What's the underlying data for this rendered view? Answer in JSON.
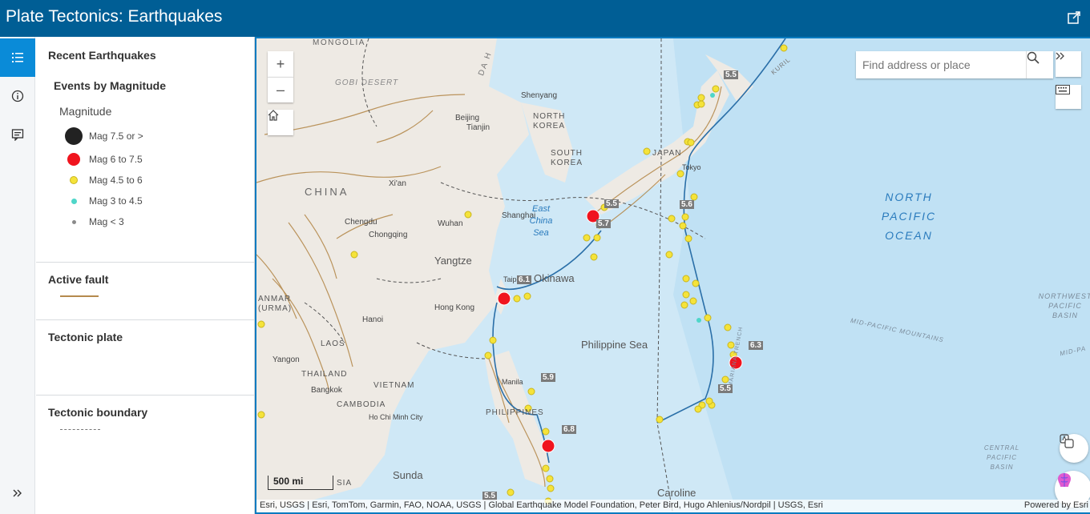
{
  "app": {
    "title": "Plate Tectonics: Earthquakes"
  },
  "rail": {
    "items": [
      {
        "name": "legend",
        "icon": "legend-list-icon",
        "active": true
      },
      {
        "name": "about",
        "icon": "info-icon",
        "active": false
      },
      {
        "name": "details",
        "icon": "details-panel-icon",
        "active": false
      }
    ],
    "expand_icon": "double-chevron-right-icon"
  },
  "legend": {
    "section1_title": "Recent Earthquakes",
    "subsection_title": "Events by Magnitude",
    "field_label": "Magnitude",
    "classes": [
      {
        "label": "Mag 7.5 or >",
        "color": "#222222"
      },
      {
        "label": "Mag 6 to 7.5",
        "color": "#f0141e"
      },
      {
        "label": "Mag 4.5 to 6",
        "color": "#f5e33a"
      },
      {
        "label": "Mag 3 to 4.5",
        "color": "#4fd6c9"
      },
      {
        "label": "Mag < 3",
        "color": "#8a8a8a"
      }
    ],
    "fault_title": "Active fault",
    "fault_color": "#b58a4d",
    "plate_title": "Tectonic plate",
    "boundary_title": "Tectonic boundary"
  },
  "map": {
    "search_placeholder": "Find address or place",
    "zoom_in": "+",
    "zoom_out": "–",
    "scale_label": "500 mi",
    "attribution": "Esri, USGS | Esri, TomTom, Garmin, FAO, NOAA, USGS | Global Earthquake Model Foundation, Peter Bird, Hugo Ahlenius/Nordpil | USGS, Esri",
    "powered_by": "Powered by Esri",
    "labels": {
      "mongolia": "MONGOLIA",
      "gobi": "GOBI DESERT",
      "china": "CHINA",
      "da_h": "DA H",
      "shenyang": "Shenyang",
      "beijing": "Beijing",
      "tianjin": "Tianjin",
      "north_korea": "NORTH KOREA",
      "south_korea": "SOUTH KOREA",
      "japan": "JAPAN",
      "tokyo": "Tokyo",
      "xian": "Xi'an",
      "wuhan": "Wuhan",
      "shanghai": "Shanghai",
      "chengdu": "Chengdu",
      "chongqing": "Chongqing",
      "yangtze": "Yangtze",
      "east_china_sea": "East China Sea",
      "okinawa": "Okinawa",
      "taipei": "Taipei",
      "hong_kong": "Hong Kong",
      "hanoi": "Hanoi",
      "laos": "LAOS",
      "anmar": "ANMAR (URMA)",
      "yangon": "Yangon",
      "thailand": "THAILAND",
      "vietnam": "VIETNAM",
      "bangkok": "Bangkok",
      "cambodia": "CAMBODIA",
      "hcmc": "Ho Chi Minh City",
      "manila": "Manila",
      "philippines": "PHILIPPINES",
      "philippine_sea": "Philippine Sea",
      "sunda": "Sunda",
      "sia": "SIA",
      "caroline": "Caroline",
      "north_pacific_ocean": "NORTH PACIFIC OCEAN",
      "kuril": "KURIL",
      "nw_pacific_basin": "NORTHWEST PACIFIC BASIN",
      "mid_pacific_mtns": "MID-PACIFIC MOUNTAINS",
      "mid_pa": "MID-PA",
      "central_pacific_basin": "CENTRAL PACIFIC BASIN",
      "mariana": "MARIANA TRENCH"
    },
    "magnitude_tags": [
      "5.5",
      "5.5",
      "5.7",
      "5.6",
      "6.1",
      "5.9",
      "6.8",
      "6.3",
      "5.5",
      "5.5"
    ]
  }
}
